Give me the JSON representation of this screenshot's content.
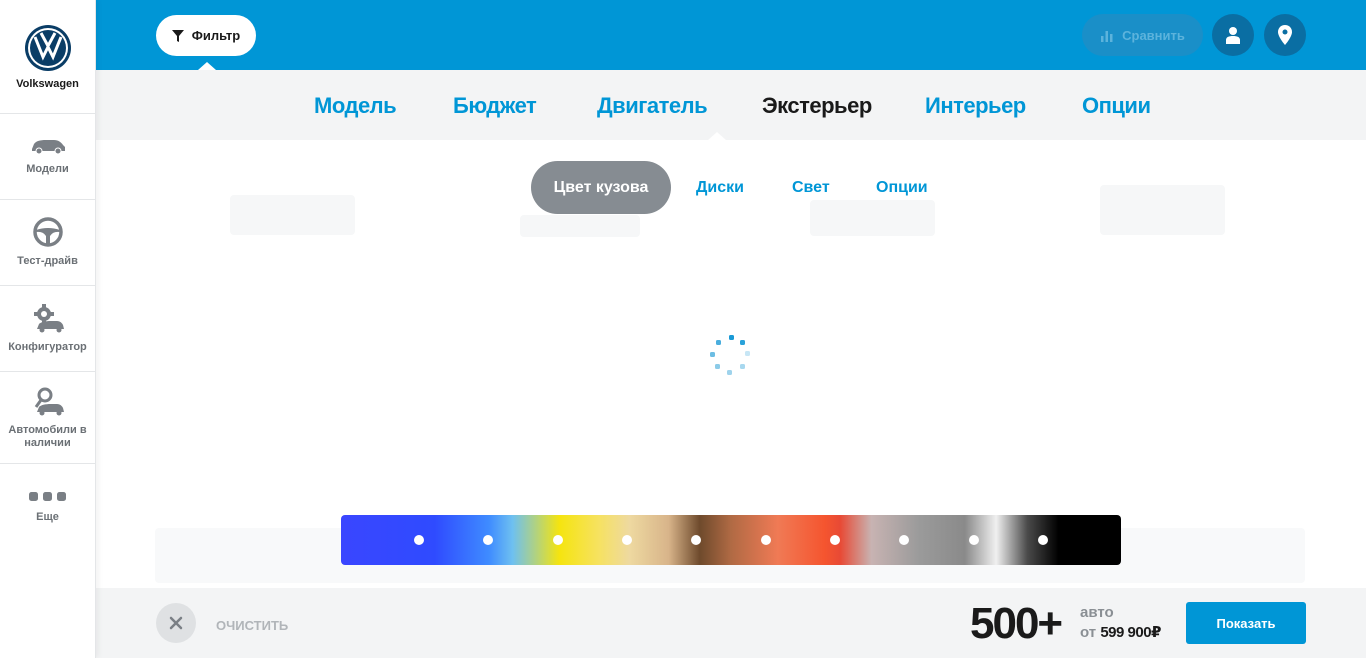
{
  "brand": {
    "name": "Volkswagen",
    "logo": "vw-logo"
  },
  "sidebar": {
    "items": [
      {
        "label": "Модели",
        "icon": "car-icon"
      },
      {
        "label": "Тест-драйв",
        "icon": "steering-wheel-icon"
      },
      {
        "label": "Конфигуратор",
        "icon": "gear-car-icon"
      },
      {
        "label": "Автомобили в наличии",
        "icon": "search-car-icon"
      },
      {
        "label": "Еще",
        "icon": "more-dots-icon"
      }
    ]
  },
  "topbar": {
    "filter_label": "Фильтр",
    "compare_label": "Сравнить",
    "user_icon": "user-icon",
    "location_icon": "location-pin-icon",
    "bg_color": "#0096d6"
  },
  "main_tabs": [
    {
      "label": "Модель",
      "active": false
    },
    {
      "label": "Бюджет",
      "active": false
    },
    {
      "label": "Двигатель",
      "active": false
    },
    {
      "label": "Экстерьер",
      "active": true
    },
    {
      "label": "Интерьер",
      "active": false
    },
    {
      "label": "Опции",
      "active": false
    }
  ],
  "sub_tabs": [
    {
      "label": "Цвет кузова",
      "active": true
    },
    {
      "label": "Диски",
      "active": false
    },
    {
      "label": "Свет",
      "active": false
    },
    {
      "label": "Опции",
      "active": false
    }
  ],
  "color_swatches": [
    "blue",
    "light-blue",
    "yellow",
    "beige",
    "brown",
    "orange",
    "red",
    "grey",
    "silver",
    "black"
  ],
  "bottombar": {
    "clear_label": "очистить",
    "count": "500+",
    "count_unit": "авто",
    "price_prefix": "от",
    "price": "599 900₽",
    "show_label": "Показать"
  }
}
